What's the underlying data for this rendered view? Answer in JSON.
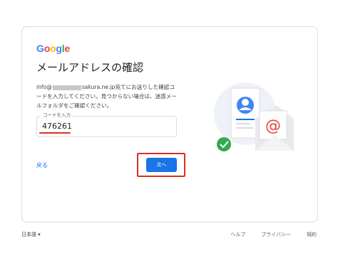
{
  "logo": {
    "letters": [
      {
        "ch": "G",
        "color": "#4285f4"
      },
      {
        "ch": "o",
        "color": "#ea4335"
      },
      {
        "ch": "o",
        "color": "#fbbc05"
      },
      {
        "ch": "g",
        "color": "#4285f4"
      },
      {
        "ch": "l",
        "color": "#34a853"
      },
      {
        "ch": "e",
        "color": "#ea4335"
      }
    ]
  },
  "page": {
    "title": "メールアドレスの確認",
    "desc_prefix": "info@",
    "desc_domain": "sakura.ne.jp",
    "desc_rest": "宛てにお送りした確認コードを入力してください。見つからない場合は、迷惑メールフォルダをご確認ください。"
  },
  "code_field": {
    "label": "コードを入力",
    "value": "476261"
  },
  "actions": {
    "back": "戻る",
    "next": "次へ"
  },
  "footer": {
    "language": "日本語 ▾",
    "help": "ヘルプ",
    "privacy": "プライバシー",
    "terms": "規約"
  },
  "colors": {
    "accent": "#1a73e8",
    "highlight": "#d93025",
    "success": "#34a853"
  }
}
